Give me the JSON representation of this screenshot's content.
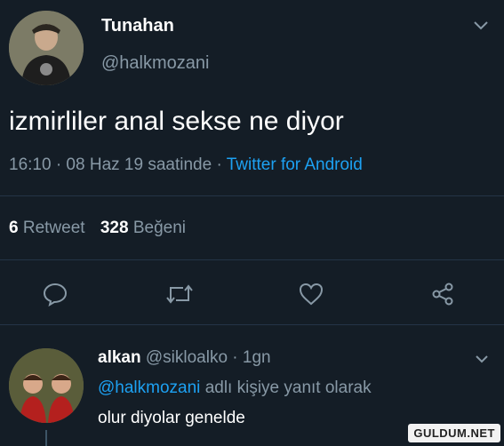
{
  "tweet": {
    "display_name": "Tunahan",
    "handle": "@halkmozani",
    "text": "izmirliler anal sekse ne diyor",
    "time": "16:10 · 08 Haz 19 saatinde",
    "separator": "·",
    "source": "Twitter for Android",
    "retweet_count": "6",
    "retweet_label": "Retweet",
    "like_count": "328",
    "like_label": "Beğeni"
  },
  "actions": [
    "reply-icon",
    "retweet-icon",
    "like-icon",
    "share-icon"
  ],
  "reply": {
    "display_name": "alkan",
    "handle_time": "@sikloalko · 1gn",
    "replying_handle": "@halkmozani",
    "replying_suffix": "adlı kişiye yanıt olarak",
    "text": "olur diyolar genelde"
  },
  "watermark": "GULDUM.NET",
  "colors": {
    "background": "#141d26",
    "accent": "#1da1f2",
    "muted": "#8899a6",
    "divider": "#243447"
  }
}
